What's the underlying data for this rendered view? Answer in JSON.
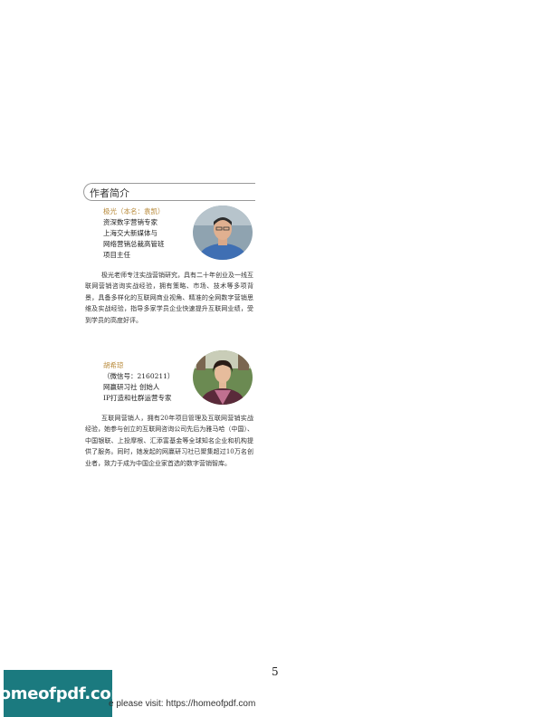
{
  "section": {
    "title": "作者简介"
  },
  "author1": {
    "name": "极光（本名：袁凯）",
    "titles": [
      "资深数字营销专家",
      "上海交大新媒体与",
      "网络营销总裁高管班",
      "项目主任"
    ],
    "bio": "极光老师专注实战营销研究，具有二十年创业及一线互联网营销咨询实战经验，拥有策略、市场、技术等多项背景，具备多样化的互联网商业视角、精准的全网数字营销思维及实战经验，指导多家学员企业快速提升互联网业绩，受到学员的高度好评。"
  },
  "author2": {
    "name": "胡希琼",
    "titles": [
      "（微信号：2160211）",
      "网赢研习社 创始人",
      "IP打造和社群运营专家"
    ],
    "bio": "互联网营销人，拥有20年项目管理及互联网营销实战经验，她参与创立的互联网咨询公司先后为雅马哈（中国）、中国银联、上投摩根、汇添富基金等全球知名企业和机构提供了服务。同时，她发起的网赢研习社已聚集超过10万名创业者，致力于成为中国企业家首选的数字营销智库。"
  },
  "page": {
    "number": "5"
  },
  "banner": {
    "logo_text": "homeofpdf.com",
    "text": "e please visit: https://homeofpdf.com"
  }
}
